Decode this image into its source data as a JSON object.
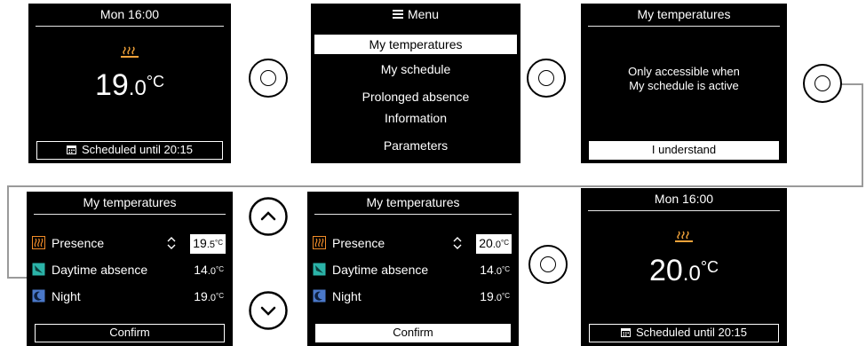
{
  "screen1": {
    "header": "Mon 16:00",
    "temp_int": "19",
    "temp_dec": ".0",
    "unit": "°C",
    "footer": "Scheduled until 20:15"
  },
  "screen2": {
    "header": "Menu",
    "items": [
      "My temperatures",
      "My schedule",
      "Prolonged absence",
      "Information",
      "Parameters"
    ],
    "selected_index": 0
  },
  "screen3": {
    "header": "My temperatures",
    "message_line1": "Only accessible when",
    "message_line2": "My schedule is active",
    "button": "I understand"
  },
  "screen4": {
    "header": "My temperatures",
    "rows": [
      {
        "label": "Presence",
        "int": "19",
        "dec": ".5",
        "unit": "°C",
        "icon": "presence-icon",
        "editing": true
      },
      {
        "label": "Daytime absence",
        "int": "14",
        "dec": ".0",
        "unit": "°C",
        "icon": "daytime-absence-icon",
        "editing": false
      },
      {
        "label": "Night",
        "int": "19",
        "dec": ".0",
        "unit": "°C",
        "icon": "night-icon",
        "editing": false
      }
    ],
    "button": "Confirm"
  },
  "screen5": {
    "header": "My temperatures",
    "rows": [
      {
        "label": "Presence",
        "int": "20",
        "dec": ".0",
        "unit": "°C",
        "icon": "presence-icon",
        "editing": true
      },
      {
        "label": "Daytime absence",
        "int": "14",
        "dec": ".0",
        "unit": "°C",
        "icon": "daytime-absence-icon",
        "editing": false
      },
      {
        "label": "Night",
        "int": "19",
        "dec": ".0",
        "unit": "°C",
        "icon": "night-icon",
        "editing": false
      }
    ],
    "button": "Confirm"
  },
  "screen6": {
    "header": "Mon 16:00",
    "temp_int": "20",
    "temp_dec": ".0",
    "unit": "°C",
    "footer": "Scheduled until 20:15"
  },
  "colors": {
    "heat_icon": "#f2a33a",
    "presence_icon": "#f28c28",
    "daytime_icon": "#2bb3a8",
    "night_icon": "#4a78c9",
    "connector": "#9a9a9a"
  },
  "controls": [
    "knob-button",
    "knob-button",
    "knob-button",
    "up-arrow-button",
    "down-arrow-button",
    "knob-button"
  ]
}
